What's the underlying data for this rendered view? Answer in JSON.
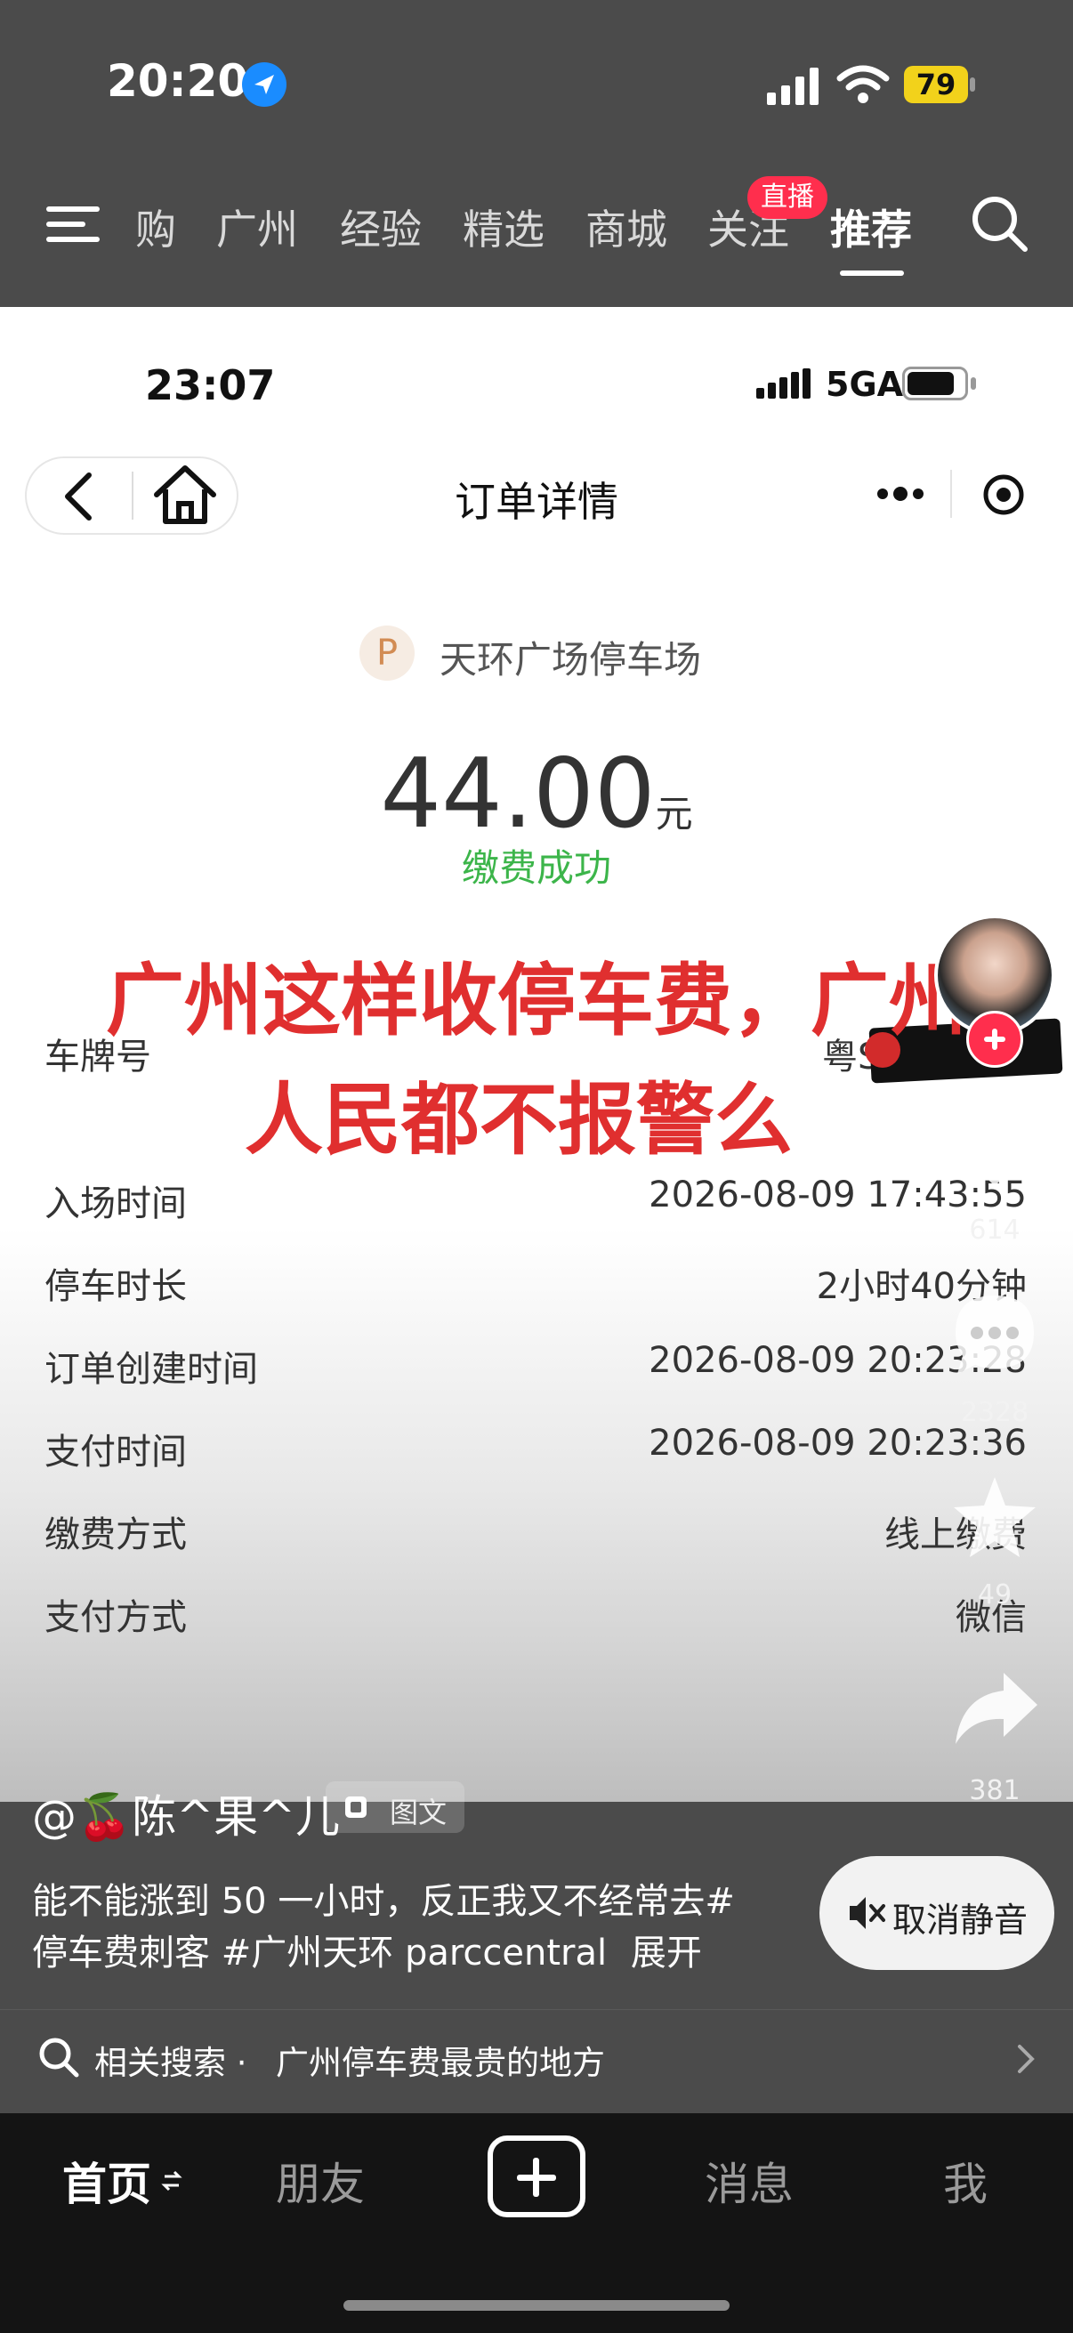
{
  "status_bar": {
    "time": "20:20",
    "battery": "79"
  },
  "top_nav": {
    "tabs": [
      "购",
      "广州",
      "经验",
      "精选",
      "商城",
      "关注",
      "推荐"
    ],
    "live_badge": "直播",
    "active_tab": "推荐"
  },
  "inner_status": {
    "time": "23:07",
    "network": "5GA"
  },
  "inner_header": {
    "title": "订单详情"
  },
  "order": {
    "park_initial": "P",
    "park_name": "天环广场停车场",
    "amount": "44.00",
    "currency": "元",
    "pay_status": "缴费成功",
    "plate_label": "车牌号",
    "plate_value": "粤S",
    "rows": [
      {
        "label": "入场时间",
        "value": "2026-08-09 17:43:55"
      },
      {
        "label": "停车时长",
        "value": "2小时40分钟"
      },
      {
        "label": "订单创建时间",
        "value": "2026-08-09 20:23:28"
      },
      {
        "label": "支付时间",
        "value": "2026-08-09 20:23:36"
      },
      {
        "label": "缴费方式",
        "value": "线上缴费"
      },
      {
        "label": "支付方式",
        "value": "微信"
      }
    ]
  },
  "overlay": {
    "line1": "广州这样收停车费，广州",
    "line2": "人民都不报警么"
  },
  "side_actions": {
    "likes": "614",
    "comments": "2328",
    "favorites": "49",
    "shares": "381"
  },
  "post": {
    "author": "@🍒陈^果^儿",
    "type_badge": "图文",
    "caption_line1": "能不能涨到 50 一小时，反正我又不经常去#",
    "caption_line2": "停车费刺客 #广州天环 parccentral",
    "expand": "展开",
    "unmute": "取消静音"
  },
  "related_search": {
    "prefix": "相关搜索 · ",
    "query": "广州停车费最贵的地方"
  },
  "bottom_nav": {
    "home": "首页",
    "friends": "朋友",
    "messages": "消息",
    "me": "我"
  },
  "colors": {
    "headline": "#e02f2f",
    "success": "#3cb54a",
    "badge": "#ff2e4d",
    "battery": "#f2d21b"
  }
}
